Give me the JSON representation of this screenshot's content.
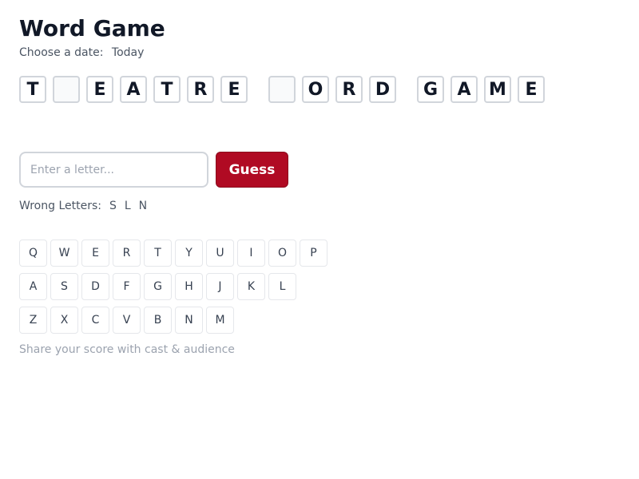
{
  "title": "Word Game",
  "date_picker": {
    "label": "Choose a date:",
    "value": "Today"
  },
  "puzzle": {
    "words": [
      [
        "T",
        "",
        "E",
        "A",
        "T",
        "R",
        "E"
      ],
      [
        "",
        "O",
        "R",
        "D"
      ],
      [
        "G",
        "A",
        "M",
        "E"
      ]
    ]
  },
  "guess_form": {
    "placeholder": "Enter a letter...",
    "value": "",
    "button_label": "Guess"
  },
  "wrong_letters": {
    "label": "Wrong Letters:",
    "letters": [
      "S",
      "L",
      "N"
    ]
  },
  "keyboard": {
    "rows": [
      [
        "Q",
        "W",
        "E",
        "R",
        "T",
        "Y",
        "U",
        "I",
        "O",
        "P"
      ],
      [
        "A",
        "S",
        "D",
        "F",
        "G",
        "H",
        "J",
        "K",
        "L"
      ],
      [
        "Z",
        "X",
        "C",
        "V",
        "B",
        "N",
        "M"
      ]
    ]
  },
  "share_text": "Share your score with cast & audience",
  "colors": {
    "accent": "#b00a23",
    "text": "#111827",
    "muted": "#4b5563",
    "border": "#d1d5db"
  }
}
